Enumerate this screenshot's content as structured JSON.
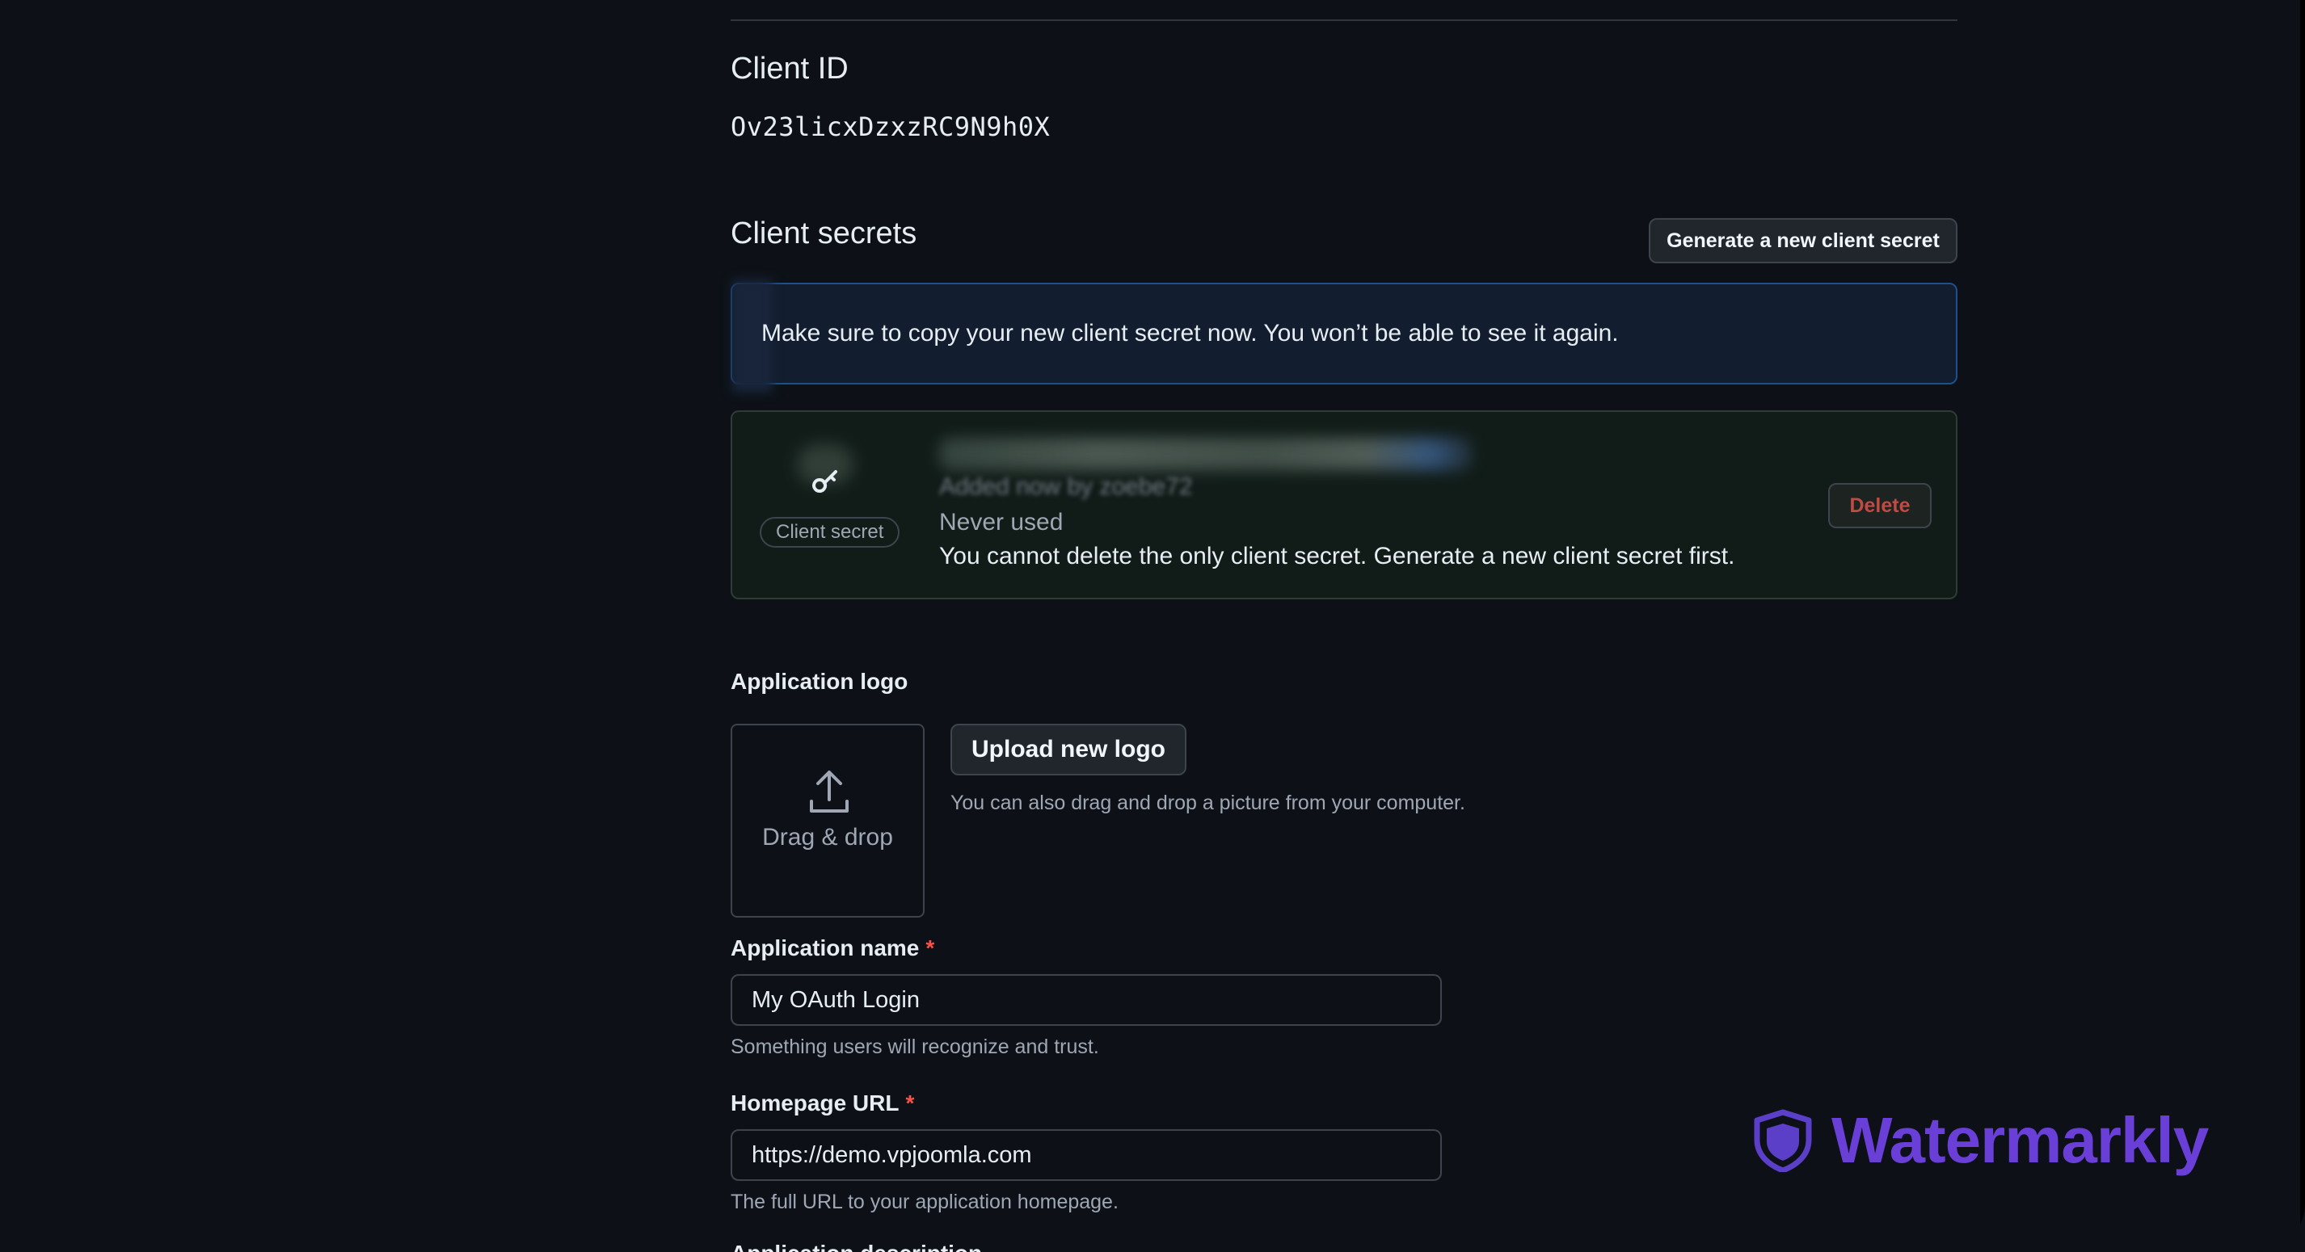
{
  "client_id": {
    "title": "Client ID",
    "value": "Ov23licxDzxzRC9N9h0X"
  },
  "client_secrets": {
    "title": "Client secrets",
    "generate_button": "Generate a new client secret",
    "flash_message": "Make sure to copy your new client secret now. You won’t be able to see it again.",
    "secret": {
      "label": "Client secret",
      "added_text": "Added now by zoebe72",
      "usage": "Never used",
      "warning": "You cannot delete the only client secret. Generate a new client secret first.",
      "delete_button": "Delete"
    }
  },
  "application_logo": {
    "label": "Application logo",
    "drop_text": "Drag & drop",
    "upload_button": "Upload new logo",
    "hint": "You can also drag and drop a picture from your computer."
  },
  "application_name": {
    "label": "Application name",
    "required_mark": "*",
    "value": "My OAuth Login",
    "hint": "Something users will recognize and trust."
  },
  "homepage_url": {
    "label": "Homepage URL",
    "required_mark": "*",
    "value": "https://demo.vpjoomla.com",
    "hint": "The full URL to your application homepage."
  },
  "application_description": {
    "label": "Application description"
  },
  "watermark": {
    "text": "Watermarkly",
    "icon": "shield-icon",
    "color": "#6a3fd8"
  },
  "colors": {
    "background": "#0d1117",
    "danger": "#f85149",
    "flash_border": "#1f4f8f"
  }
}
